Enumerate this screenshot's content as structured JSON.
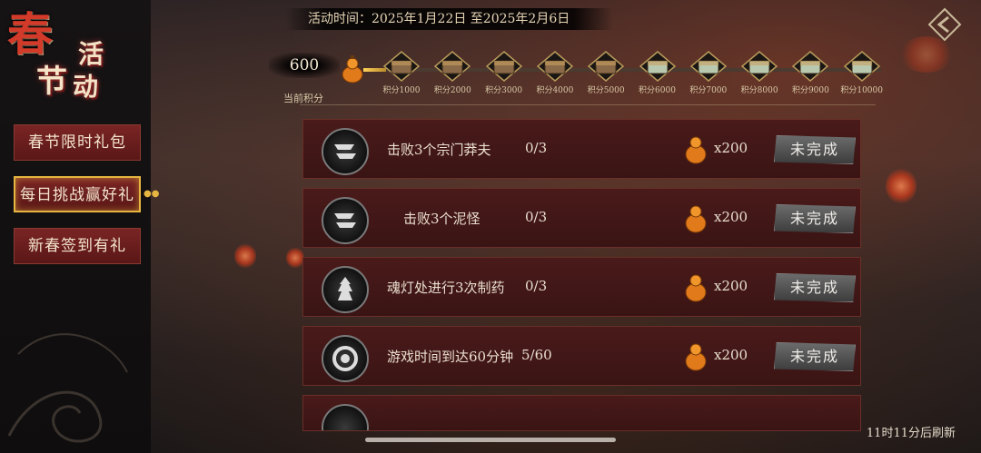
{
  "sidebar": {
    "title": {
      "big": "春",
      "chars": [
        "节",
        "活",
        "动"
      ]
    },
    "items": [
      {
        "label": "春节限时礼包",
        "active": false
      },
      {
        "label": "每日挑战赢好礼",
        "active": true
      },
      {
        "label": "新春签到有礼",
        "active": false
      }
    ]
  },
  "header": {
    "date_range": "活动时间：2025年1月22日 至2025年2月6日"
  },
  "progress": {
    "points": "600",
    "points_label": "当前积分",
    "max_points": 10000,
    "milestones": [
      {
        "label": "积分1000"
      },
      {
        "label": "积分2000"
      },
      {
        "label": "积分3000"
      },
      {
        "label": "积分4000"
      },
      {
        "label": "积分5000"
      },
      {
        "label": "积分6000"
      },
      {
        "label": "积分7000"
      },
      {
        "label": "积分8000"
      },
      {
        "label": "积分9000"
      },
      {
        "label": "积分10000"
      }
    ]
  },
  "tasks": [
    {
      "name": "击败3个宗门莽夫",
      "progress": "0/3",
      "reward": "x200",
      "status": "未完成",
      "icon": "crossed-swords-icon"
    },
    {
      "name": "击败3个泥怪",
      "progress": "0/3",
      "reward": "x200",
      "status": "未完成",
      "icon": "crossed-swords-icon"
    },
    {
      "name": "魂灯处进行3次制药",
      "progress": "0/3",
      "reward": "x200",
      "status": "未完成",
      "icon": "cauldron-icon"
    },
    {
      "name": "游戏时间到达60分钟",
      "progress": "5/60",
      "reward": "x200",
      "status": "未完成",
      "icon": "clock-swirl-icon"
    }
  ],
  "footer": {
    "refresh_text": "11时11分后刷新"
  },
  "colors": {
    "active_border": "#e6b640",
    "button_red": "#7a2424",
    "status_gray": "#5a5a5a"
  }
}
